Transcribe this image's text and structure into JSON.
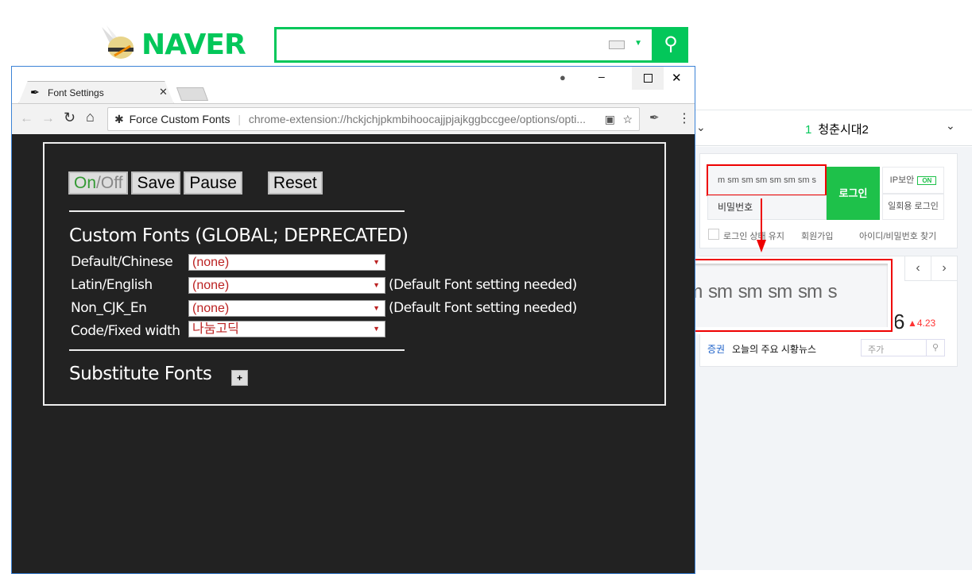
{
  "naver": {
    "logo": "NAVER",
    "search": {
      "value": "",
      "placeholder": ""
    },
    "realtime": {
      "rank": "1",
      "keyword": "청춘시대2"
    },
    "login": {
      "id_value": "m sm sm sm sm sm sm s",
      "pw_placeholder": "비밀번호",
      "login_button": "로그인",
      "ip_security": "IP보안",
      "ip_state": "ON",
      "otp_login": "일회용 로그인",
      "keep_login": "로그인 상태 유지",
      "signup": "회원가입",
      "find": "아이디/비밀번호 찾기"
    },
    "stock": {
      "value_tail": "6",
      "change": "▲4.23",
      "category": "증권",
      "headline": "오늘의 주요 시황뉴스",
      "search_placeholder": "주가"
    },
    "magnified_text": "m sm sm sm sm sm sm s",
    "accent": "#03c75a",
    "highlight": "#e00000"
  },
  "browser": {
    "tab_title": "Font Settings",
    "site_chip": "Force Custom Fonts",
    "url": "chrome-extension://hckjchjpkmbihoocajjpjajkggbccgee/options/opti..."
  },
  "options": {
    "buttons": {
      "onoff_on": "On",
      "onoff_sep": "/",
      "onoff_off": "Off",
      "save": "Save",
      "pause": "Pause",
      "reset": "Reset"
    },
    "custom_title": "Custom Fonts (GLOBAL; DEPRECATED)",
    "rows": [
      {
        "label": "Default/Chinese",
        "value": "(none)",
        "note": ""
      },
      {
        "label": "Latin/English",
        "value": "(none)",
        "note": "(Default Font setting needed)"
      },
      {
        "label": "Non_CJK_En",
        "value": "(none)",
        "note": "(Default Font setting needed)"
      },
      {
        "label": "Code/Fixed width",
        "value": "나눔고딕",
        "note": ""
      }
    ],
    "substitute_title": "Substitute Fonts",
    "add_label": "+"
  }
}
